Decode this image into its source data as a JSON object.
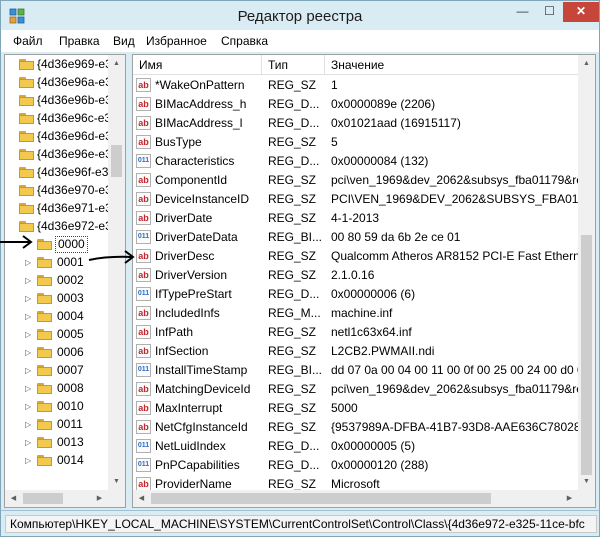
{
  "window": {
    "title": "Редактор реестра",
    "minimize": "—",
    "maximize": "☐",
    "close": "✕"
  },
  "menu": [
    {
      "label": "Файл"
    },
    {
      "label": "Правка"
    },
    {
      "label": "Вид"
    },
    {
      "label": "Избранное"
    },
    {
      "label": "Справка"
    }
  ],
  "tree": {
    "keys_top": [
      "{4d36e969-e325",
      "{4d36e96a-e325",
      "{4d36e96b-e325",
      "{4d36e96c-e325",
      "{4d36e96d-e325",
      "{4d36e96e-e325",
      "{4d36e96f-e325",
      "{4d36e970-e325",
      "{4d36e971-e325",
      "{4d36e972-e325"
    ],
    "selected": "0000",
    "subkeys": [
      "0001",
      "0002",
      "0003",
      "0004",
      "0005",
      "0006",
      "0007",
      "0008",
      "0010",
      "0011",
      "0013",
      "0014"
    ]
  },
  "list": {
    "columns": {
      "name": "Имя",
      "type": "Тип",
      "value": "Значение"
    },
    "rows": [
      {
        "icon": "string-value-icon",
        "name": "*WakeOnPattern",
        "type": "REG_SZ",
        "value": "1"
      },
      {
        "icon": "string-value-icon",
        "name": "BIMacAddress_h",
        "type": "REG_D...",
        "value": "0x0000089e (2206)"
      },
      {
        "icon": "string-value-icon",
        "name": "BIMacAddress_l",
        "type": "REG_D...",
        "value": "0x01021aad (16915117)"
      },
      {
        "icon": "string-value-icon",
        "name": "BusType",
        "type": "REG_SZ",
        "value": "5"
      },
      {
        "icon": "binary-value-icon",
        "name": "Characteristics",
        "type": "REG_D...",
        "value": "0x00000084 (132)"
      },
      {
        "icon": "string-value-icon",
        "name": "ComponentId",
        "type": "REG_SZ",
        "value": "pci\\ven_1969&dev_2062&subsys_fba01179&re"
      },
      {
        "icon": "string-value-icon",
        "name": "DeviceInstanceID",
        "type": "REG_SZ",
        "value": "PCI\\VEN_1969&DEV_2062&SUBSYS_FBA01179"
      },
      {
        "icon": "string-value-icon",
        "name": "DriverDate",
        "type": "REG_SZ",
        "value": "4-1-2013"
      },
      {
        "icon": "binary-value-icon",
        "name": "DriverDateData",
        "type": "REG_BI...",
        "value": "00 80 59 da 6b 2e ce 01"
      },
      {
        "icon": "string-value-icon",
        "name": "DriverDesc",
        "type": "REG_SZ",
        "value": "Qualcomm Atheros AR8152 PCI-E Fast Etherne"
      },
      {
        "icon": "string-value-icon",
        "name": "DriverVersion",
        "type": "REG_SZ",
        "value": "2.1.0.16"
      },
      {
        "icon": "binary-value-icon",
        "name": "IfTypePreStart",
        "type": "REG_D...",
        "value": "0x00000006 (6)"
      },
      {
        "icon": "string-value-icon",
        "name": "IncludedInfs",
        "type": "REG_M...",
        "value": "machine.inf"
      },
      {
        "icon": "string-value-icon",
        "name": "InfPath",
        "type": "REG_SZ",
        "value": "netl1c63x64.inf"
      },
      {
        "icon": "string-value-icon",
        "name": "InfSection",
        "type": "REG_SZ",
        "value": "L2CB2.PWMAII.ndi"
      },
      {
        "icon": "binary-value-icon",
        "name": "InstallTimeStamp",
        "type": "REG_BI...",
        "value": "dd 07 0a 00 04 00 11 00 0f 00 25 00 24 00 d0 00"
      },
      {
        "icon": "string-value-icon",
        "name": "MatchingDeviceId",
        "type": "REG_SZ",
        "value": "pci\\ven_1969&dev_2062&subsys_fba01179&re"
      },
      {
        "icon": "string-value-icon",
        "name": "MaxInterrupt",
        "type": "REG_SZ",
        "value": "5000"
      },
      {
        "icon": "string-value-icon",
        "name": "NetCfgInstanceId",
        "type": "REG_SZ",
        "value": "{9537989A-DFBA-41B7-93D8-AAE636C78028}"
      },
      {
        "icon": "binary-value-icon",
        "name": "NetLuidIndex",
        "type": "REG_D...",
        "value": "0x00000005 (5)"
      },
      {
        "icon": "binary-value-icon",
        "name": "PnPCapabilities",
        "type": "REG_D...",
        "value": "0x00000120 (288)"
      },
      {
        "icon": "string-value-icon",
        "name": "ProviderName",
        "type": "REG_SZ",
        "value": "Microsoft"
      }
    ]
  },
  "status": {
    "path": "Компьютер\\HKEY_LOCAL_MACHINE\\SYSTEM\\CurrentControlSet\\Control\\Class\\{4d36e972-e325-11ce-bfc"
  },
  "colors": {
    "frame": "#d9ecf4",
    "close_button": "#c7463a",
    "string_icon": "#c0282d",
    "binary_icon": "#2a6cc4"
  }
}
